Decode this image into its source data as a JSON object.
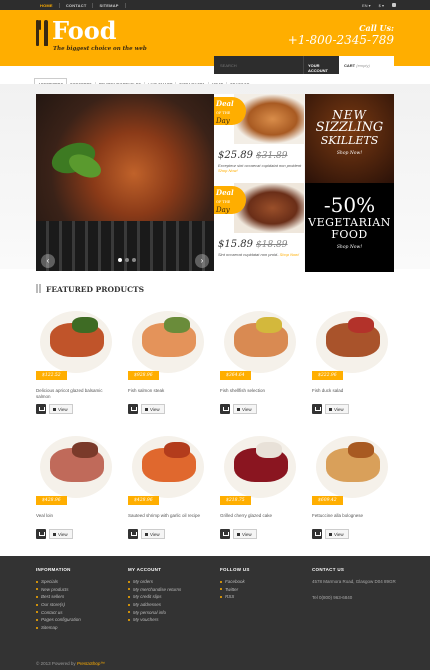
{
  "topbar": {
    "nav": [
      "HOME",
      "CONTACT",
      "SITEMAP"
    ],
    "lang": "EN",
    "currency": "$"
  },
  "header": {
    "logo_title": "Food",
    "tagline": "The biggest choice on the web",
    "call_label": "Call Us:",
    "phone": "+1-800-2345-789",
    "search_placeholder": "SEARCH",
    "account_label": "YOUR ACCOUNT",
    "cart_label": "CART",
    "cart_empty": "(empty)"
  },
  "menu": [
    "APPETIZERS",
    "DESSERTS",
    "FRUITS/VEGETABLES",
    "LIVE SMART",
    "PIZZA/PASTA",
    "MEAT",
    "SEAFOOD"
  ],
  "deals": [
    {
      "tag1": "Deal",
      "tag_small": "OF THE",
      "tag2": "Day",
      "price": "$25.89",
      "old_price": "$31.89",
      "desc": "Excepteur sint occaecat cupidatat non proident",
      "shop": "Shop Now!"
    },
    {
      "tag1": "Deal",
      "tag_small": "OF THE",
      "tag2": "Day",
      "price": "$15.89",
      "old_price": "$18.89",
      "desc": "Sint occaecat cupidatat non proid-",
      "shop": "Shop Now!"
    }
  ],
  "promos": [
    {
      "a": "NEW",
      "b": "SIZZLING",
      "c": "SKILLETS",
      "shop": "Shop Now!"
    },
    {
      "a": "-50%",
      "b": "VEGETARIAN",
      "c": "FOOD",
      "shop": "Shop Now!"
    }
  ],
  "featured_title": "FEATURED PRODUCTS",
  "products": [
    {
      "price": "$122.52",
      "name": "Delicious apricot glazed balsamic salmon",
      "view": "View",
      "colors": [
        "#c0542a",
        "#3e6b24"
      ]
    },
    {
      "price": "$928.96",
      "name": "Fish salmon steak",
      "view": "View",
      "colors": [
        "#e4935a",
        "#6a8c3a"
      ]
    },
    {
      "price": "$364.64",
      "name": "Fish shellfish selection",
      "view": "View",
      "colors": [
        "#d98a52",
        "#d3b83c"
      ]
    },
    {
      "price": "$222.96",
      "name": "Fish duck salad",
      "view": "View",
      "colors": [
        "#a9532b",
        "#b3322a"
      ]
    },
    {
      "price": "$428.96",
      "name": "Veal loin",
      "view": "View",
      "colors": [
        "#c06a5a",
        "#7a3a2a"
      ]
    },
    {
      "price": "$428.96",
      "name": "Sauteed shrimp with garlic oil recipe",
      "view": "View",
      "colors": [
        "#e0682e",
        "#b33c1c"
      ]
    },
    {
      "price": "$218.75",
      "name": "Grilled cherry glazed cake",
      "view": "View",
      "colors": [
        "#8a1520",
        "#e8e1d8"
      ]
    },
    {
      "price": "$609.42",
      "name": "Fettuccine alla bolognese",
      "view": "View",
      "colors": [
        "#d9a05a",
        "#a85a22"
      ]
    }
  ],
  "footer": {
    "info": {
      "title": "INFORMATION",
      "items": [
        "Specials",
        "New products",
        "Best sellers",
        "Our store(s)",
        "Contact us",
        "Pages configuration",
        "Sitemap"
      ]
    },
    "account": {
      "title": "MY ACCOUNT",
      "items": [
        "My orders",
        "My merchandise returns",
        "My credit slips",
        "My addresses",
        "My personal info",
        "My vouchers"
      ]
    },
    "follow": {
      "title": "FOLLOW US",
      "items": [
        "Facebook",
        "Twitter",
        "RSS"
      ]
    },
    "contact": {
      "title": "CONTACT US",
      "address": "4578 Marmora Road, Glasgow D04 89GR",
      "tel": "Tel 0(800) 963-6840"
    },
    "copyright": "© 2013 Powered by",
    "brand": "PrestaShop™"
  }
}
